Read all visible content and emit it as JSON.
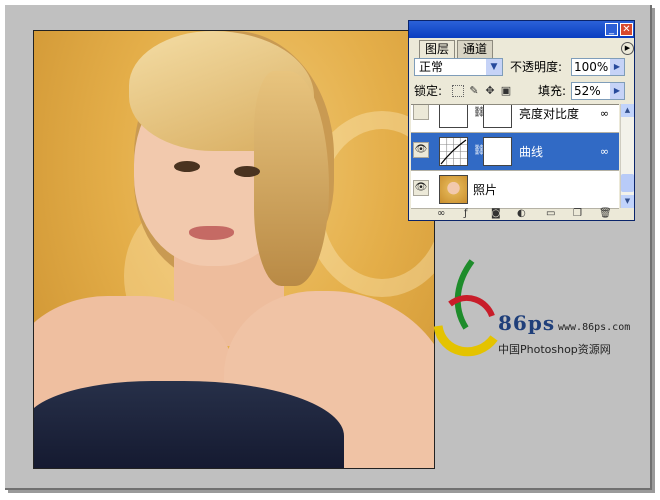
{
  "panel": {
    "tabs": [
      "图层",
      "通道"
    ],
    "blend_mode": "正常",
    "opacity_label": "不透明度:",
    "opacity_value": "100%",
    "lock_label": "锁定:",
    "fill_label": "填充:",
    "fill_value": "52%",
    "layers": [
      {
        "name": "亮度对比度",
        "kind": "adjustment",
        "visible": false,
        "selected": false
      },
      {
        "name": "曲线",
        "kind": "adjustment",
        "visible": true,
        "selected": true
      },
      {
        "name": "照片",
        "kind": "image",
        "visible": true,
        "selected": false
      }
    ],
    "selected_color": "#316ac5"
  },
  "watermark": {
    "number": "86ps",
    "url": "www.86ps.com",
    "caption": "中国Photoshop资源网"
  },
  "colors": {
    "canvas_bg": "#c0c0c0",
    "titlebar": "#0a3ec0",
    "panel_bg": "#ece9d8"
  }
}
